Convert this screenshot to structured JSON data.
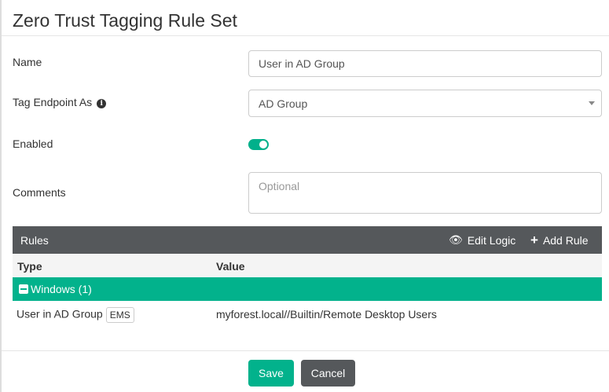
{
  "title": "Zero Trust Tagging Rule Set",
  "form": {
    "name_label": "Name",
    "name_value": "User in AD Group",
    "tag_label": "Tag Endpoint As",
    "tag_value": "AD Group",
    "enabled_label": "Enabled",
    "enabled": true,
    "comments_label": "Comments",
    "comments_placeholder": "Optional"
  },
  "rules": {
    "title": "Rules",
    "edit_logic": "Edit Logic",
    "add_rule": "Add Rule",
    "columns": [
      "Type",
      "Value"
    ],
    "group": "Windows (1)",
    "rows": [
      {
        "type": "User in AD Group",
        "badge": "EMS",
        "value": "myforest.local//Builtin/Remote Desktop Users"
      }
    ]
  },
  "footer": {
    "save": "Save",
    "cancel": "Cancel"
  },
  "colors": {
    "accent": "#02b28c",
    "bar": "#55585b"
  }
}
